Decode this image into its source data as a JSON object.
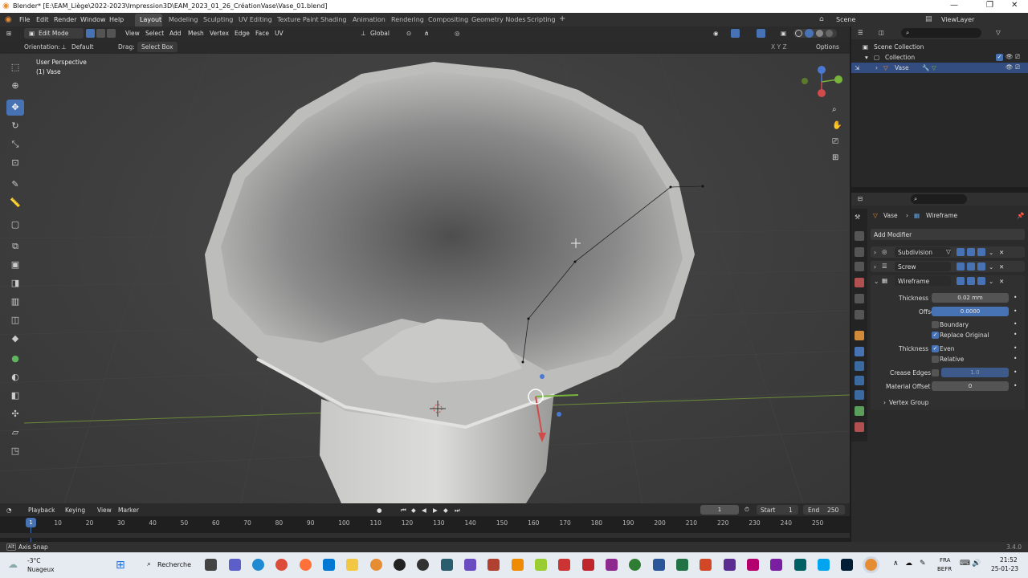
{
  "titlebar": {
    "title": "Blender* [E:\\EAM_Liège\\2022-2023\\Impression3D\\EAM_2023_01_26_CréationVase\\Vase_01.blend]",
    "minimize": "—",
    "maximize": "❐",
    "close": "✕"
  },
  "menu": {
    "file": "File",
    "edit": "Edit",
    "render": "Render",
    "window": "Window",
    "help": "Help"
  },
  "workspaces": [
    "Layout",
    "Modeling",
    "Sculpting",
    "UV Editing",
    "Texture Paint",
    "Shading",
    "Animation",
    "Rendering",
    "Compositing",
    "Geometry Nodes",
    "Scripting"
  ],
  "workspace_add": "+",
  "scene": {
    "scene_label": "Scene",
    "viewlayer_label": "ViewLayer"
  },
  "header3d": {
    "mode": "Edit Mode",
    "menus": [
      "View",
      "Select",
      "Add",
      "Mesh",
      "Vertex",
      "Edge",
      "Face",
      "UV"
    ],
    "transform_orientation": "Global",
    "orientation_label": "Orientation:",
    "orientation_value": "Default",
    "drag_label": "Drag:",
    "drag_value": "Select Box",
    "options": "Options",
    "axes": "X Y Z"
  },
  "viewport": {
    "perspective": "User Perspective",
    "object": "(1) Vase"
  },
  "outliner": {
    "scene_collection": "Scene Collection",
    "collection": "Collection",
    "object": "Vase"
  },
  "properties": {
    "breadcrumb_object": "Vase",
    "breadcrumb_sep": "›",
    "breadcrumb_modifier": "Wireframe",
    "add_modifier": "Add Modifier",
    "modifiers": [
      "Subdivision",
      "Screw",
      "Wireframe"
    ],
    "thickness_label": "Thickness",
    "thickness_value": "0.02 mm",
    "offset_label": "Offset",
    "offset_value": "0.0000",
    "boundary_label": "Boundary",
    "replace_original_label": "Replace Original",
    "thickness2_label": "Thickness",
    "even_label": "Even",
    "relative_label": "Relative",
    "crease_label": "Crease Edges",
    "crease_value": "1.0",
    "material_offset_label": "Material Offset",
    "material_offset_value": "0",
    "vertex_group": "Vertex Group"
  },
  "timeline": {
    "menus": [
      "Playback",
      "Keying",
      "View",
      "Marker"
    ],
    "current_frame": "1",
    "start_label": "Start",
    "start_value": "1",
    "end_label": "End",
    "end_value": "250",
    "ruler": [
      "1",
      "10",
      "20",
      "30",
      "40",
      "50",
      "60",
      "70",
      "80",
      "90",
      "100",
      "110",
      "120",
      "130",
      "140",
      "150",
      "160",
      "170",
      "180",
      "190",
      "200",
      "210",
      "220",
      "230",
      "240",
      "250"
    ]
  },
  "status": {
    "hint": "Axis Snap",
    "version": "3.4.0"
  },
  "taskbar": {
    "weather_temp": "-3°C",
    "weather_desc": "Nuageux",
    "search": "Recherche",
    "lang1": "FRA",
    "lang2": "BEFR",
    "time": "21:52",
    "date": "25-01-23"
  },
  "colors": {
    "accent": "#4772b3",
    "bg": "#303030",
    "active_object": "#e68c32",
    "x_axis": "#d24b4b",
    "y_axis": "#78b43c",
    "z_axis": "#4b78d2"
  }
}
